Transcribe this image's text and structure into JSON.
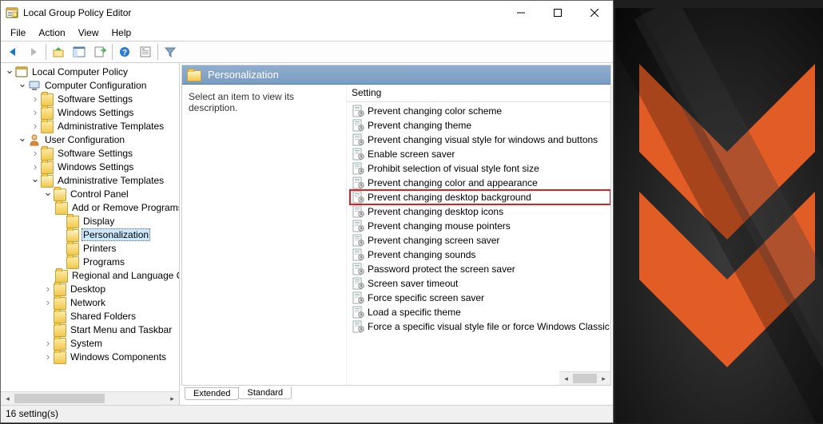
{
  "titlebar": {
    "title": "Local Group Policy Editor"
  },
  "menubar": [
    "File",
    "Action",
    "View",
    "Help"
  ],
  "tree": {
    "root": "Local Computer Policy",
    "computer_config": "Computer Configuration",
    "cc_software": "Software Settings",
    "cc_windows": "Windows Settings",
    "cc_admin": "Administrative Templates",
    "user_config": "User Configuration",
    "uc_software": "Software Settings",
    "uc_windows": "Windows Settings",
    "uc_admin": "Administrative Templates",
    "control_panel": "Control Panel",
    "cp_add": "Add or Remove Programs",
    "cp_display": "Display",
    "cp_personalization": "Personalization",
    "cp_printers": "Printers",
    "cp_programs": "Programs",
    "cp_regional": "Regional and Language Options",
    "desktop": "Desktop",
    "network": "Network",
    "shared": "Shared Folders",
    "startmenu": "Start Menu and Taskbar",
    "system": "System",
    "wincomp": "Windows Components"
  },
  "content": {
    "header": "Personalization",
    "hint": "Select an item to view its description.",
    "col": "Setting",
    "settings": [
      "Prevent changing color scheme",
      "Prevent changing theme",
      "Prevent changing visual style for windows and buttons",
      "Enable screen saver",
      "Prohibit selection of visual style font size",
      "Prevent changing color and appearance",
      "Prevent changing desktop background",
      "Prevent changing desktop icons",
      "Prevent changing mouse pointers",
      "Prevent changing screen saver",
      "Prevent changing sounds",
      "Password protect the screen saver",
      "Screen saver timeout",
      "Force specific screen saver",
      "Load a specific theme",
      "Force a specific visual style file or force Windows Classic"
    ],
    "highlight_index": 6
  },
  "tabs": {
    "extended": "Extended",
    "standard": "Standard"
  },
  "statusbar": "16 setting(s)"
}
